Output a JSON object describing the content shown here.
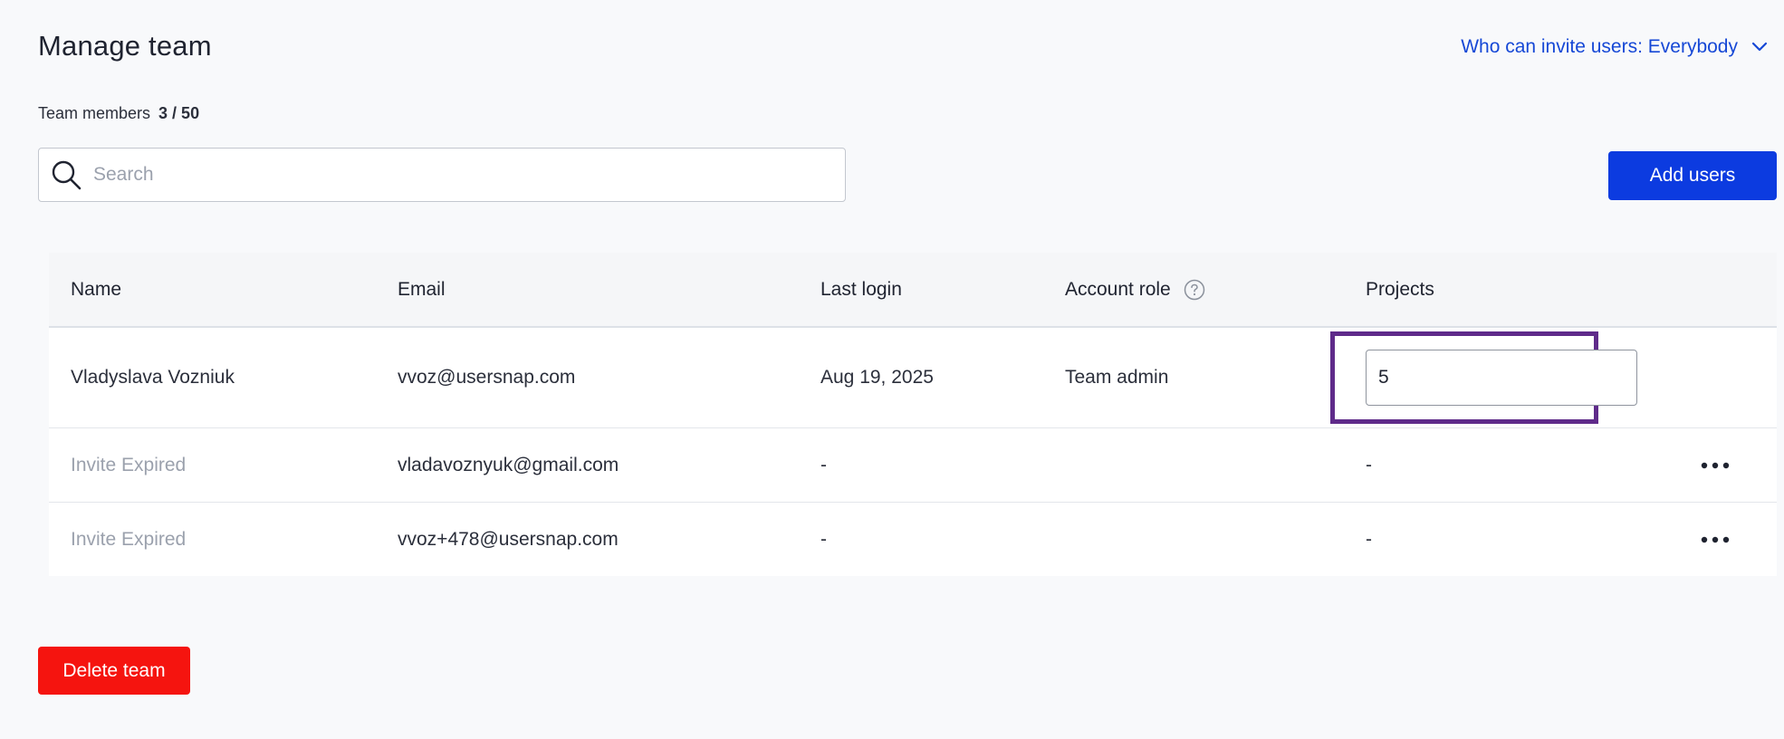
{
  "header": {
    "title": "Manage team",
    "invite_policy": "Who can invite users: Everybody",
    "invite_policy_icon": "chevron-down-icon"
  },
  "team_members": {
    "label": "Team members",
    "count": "3 / 50"
  },
  "search": {
    "placeholder": "Search",
    "value": "",
    "icon": "search-icon"
  },
  "actions": {
    "add_users_label": "Add users",
    "delete_team_label": "Delete team"
  },
  "table": {
    "columns": [
      "Name",
      "Email",
      "Last login",
      "Account role",
      "Projects"
    ],
    "account_role_help_icon": "help-circle-icon",
    "rows": [
      {
        "name": "Vladyslava Vozniuk",
        "email": "vvoz@usersnap.com",
        "last_login": "Aug 19, 2025",
        "role": "Team admin",
        "projects": "5"
      },
      {
        "name": "Invite Expired",
        "email": "vladavoznyuk@gmail.com",
        "last_login": "-",
        "role": "",
        "projects": "-",
        "menu_icon": "more-horizontal-icon"
      },
      {
        "name": "Invite Expired",
        "email": "vvoz+478@usersnap.com",
        "last_login": "-",
        "role": "",
        "projects": "-",
        "menu_icon": "more-horizontal-icon"
      }
    ]
  },
  "colors": {
    "primary": "#0c3be0",
    "danger": "#f5140f",
    "link": "#1648d6",
    "highlight": "#5f2b8a",
    "muted_text": "#9ba1ad"
  }
}
